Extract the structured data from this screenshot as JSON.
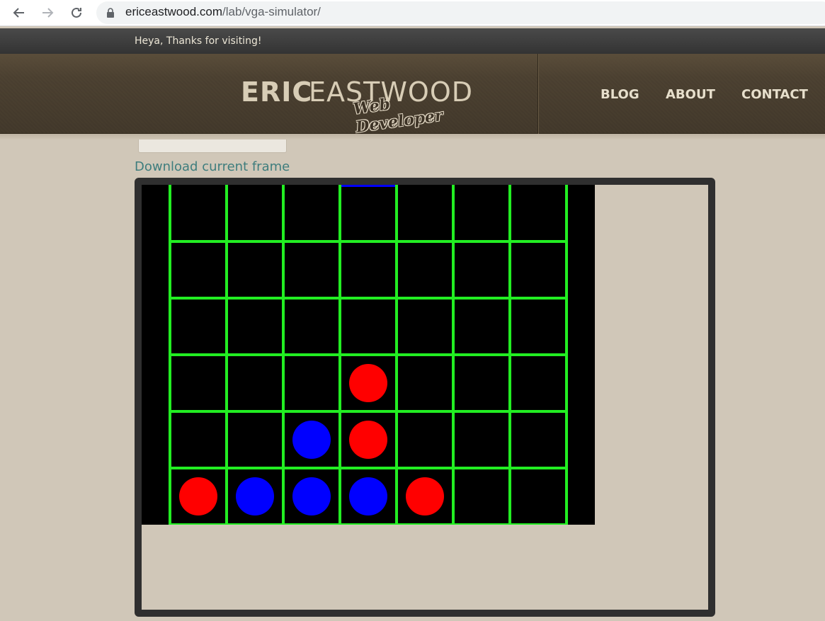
{
  "browser": {
    "url_domain": "ericeastwood.com",
    "url_path": "/lab/vga-simulator/"
  },
  "site": {
    "greeting": "Heya, Thanks for visiting!",
    "logo_bold": "ERIC",
    "logo_light": "EASTWOOD",
    "logo_sub": "Web Developer",
    "nav": [
      {
        "label": "BLOG"
      },
      {
        "label": "ABOUT"
      },
      {
        "label": "CONTACT"
      }
    ]
  },
  "content": {
    "download_label": "Download current frame"
  },
  "board": {
    "columns": 7,
    "rows": 6,
    "background_color": "#000000",
    "grid_color": "#22ee22",
    "red_color": "#ff0000",
    "blue_color": "#0000ff",
    "hover_column": 4,
    "pieces": [
      {
        "row": 1,
        "col": 1,
        "color": "red"
      },
      {
        "row": 1,
        "col": 2,
        "color": "blue"
      },
      {
        "row": 1,
        "col": 3,
        "color": "blue"
      },
      {
        "row": 1,
        "col": 4,
        "color": "blue"
      },
      {
        "row": 1,
        "col": 5,
        "color": "red"
      },
      {
        "row": 2,
        "col": 3,
        "color": "blue"
      },
      {
        "row": 2,
        "col": 4,
        "color": "red"
      },
      {
        "row": 3,
        "col": 4,
        "color": "red"
      }
    ]
  }
}
